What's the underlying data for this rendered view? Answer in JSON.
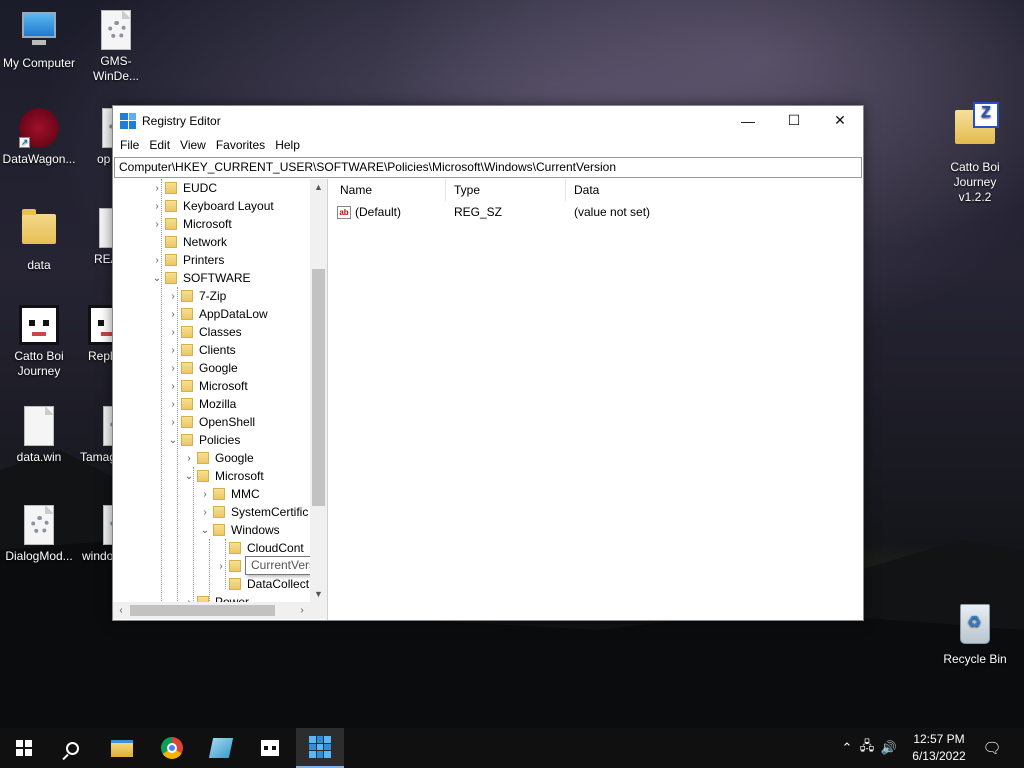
{
  "desktop": {
    "icons": [
      {
        "label": "My Computer",
        "icon": "computer-icon"
      },
      {
        "label": "GMS-WinDe...",
        "icon": "settings-file-icon"
      },
      {
        "label": "DataWagon...",
        "icon": "star-shortcut-icon"
      },
      {
        "label": "op",
        "icon": "settings-file-icon"
      },
      {
        "label": "data",
        "icon": "folder-icon"
      },
      {
        "label": "REA",
        "icon": "text-file-icon"
      },
      {
        "label": "Catto Boi Journey",
        "icon": "cat-icon"
      },
      {
        "label": "Repl",
        "icon": "cat-icon"
      },
      {
        "label": "data.win",
        "icon": "file-icon"
      },
      {
        "label": "Tamag",
        "icon": "settings-file-icon"
      },
      {
        "label": "DialogMod...",
        "icon": "settings-file-icon"
      },
      {
        "label": "windo",
        "icon": "settings-file-icon"
      },
      {
        "label": "Catto Boi Journey v1.2.2",
        "icon": "zip-folder-icon"
      },
      {
        "label": "Recycle Bin",
        "icon": "recycle-bin-icon"
      }
    ]
  },
  "window": {
    "title": "Registry Editor",
    "controls": {
      "minimize": "—",
      "maximize": "☐",
      "close": "✕"
    },
    "menu": [
      "File",
      "Edit",
      "View",
      "Favorites",
      "Help"
    ],
    "address": "Computer\\HKEY_CURRENT_USER\\SOFTWARE\\Policies\\Microsoft\\Windows\\CurrentVersion",
    "tree": [
      {
        "label": "EUDC",
        "chevron": "›"
      },
      {
        "label": "Keyboard Layout",
        "chevron": "›"
      },
      {
        "label": "Microsoft",
        "chevron": "›"
      },
      {
        "label": "Network",
        "chevron": ""
      },
      {
        "label": "Printers",
        "chevron": "›"
      },
      {
        "label": "SOFTWARE",
        "chevron": "⌄"
      },
      {
        "label": "7-Zip",
        "chevron": "›"
      },
      {
        "label": "AppDataLow",
        "chevron": "›"
      },
      {
        "label": "Classes",
        "chevron": "›"
      },
      {
        "label": "Clients",
        "chevron": "›"
      },
      {
        "label": "Google",
        "chevron": "›"
      },
      {
        "label": "Microsoft",
        "chevron": "›"
      },
      {
        "label": "Mozilla",
        "chevron": "›"
      },
      {
        "label": "OpenShell",
        "chevron": "›"
      },
      {
        "label": "Policies",
        "chevron": "⌄"
      },
      {
        "label": "Google",
        "chevron": "›"
      },
      {
        "label": "Microsoft",
        "chevron": "⌄"
      },
      {
        "label": "MMC",
        "chevron": "›"
      },
      {
        "label": "SystemCertific",
        "chevron": "›"
      },
      {
        "label": "Windows",
        "chevron": "⌄"
      },
      {
        "label": "CloudCont",
        "chevron": ""
      },
      {
        "label": "",
        "chevron": "›"
      },
      {
        "label": "DataCollect",
        "chevron": ""
      },
      {
        "label": "Power",
        "chevron": "›"
      }
    ],
    "tooltip": "CurrentVersion",
    "scroll": {
      "up": "▲",
      "down": "▼",
      "left": "‹",
      "right": "›"
    },
    "columns": {
      "name": "Name",
      "type": "Type",
      "data": "Data"
    },
    "values": [
      {
        "icon": "ab",
        "name": "(Default)",
        "type": "REG_SZ",
        "data": "(value not set)"
      }
    ]
  },
  "taskbar": {
    "clock_time": "12:57 PM",
    "clock_date": "6/13/2022",
    "tray_chevron": "⌃",
    "network_glyph": "🖧",
    "volume_glyph": "🔊",
    "notification_glyph": "🗨"
  },
  "colors": {
    "accent": "#1f7fd6",
    "taskbar": "#101010",
    "tent_glow": "#96e628"
  }
}
